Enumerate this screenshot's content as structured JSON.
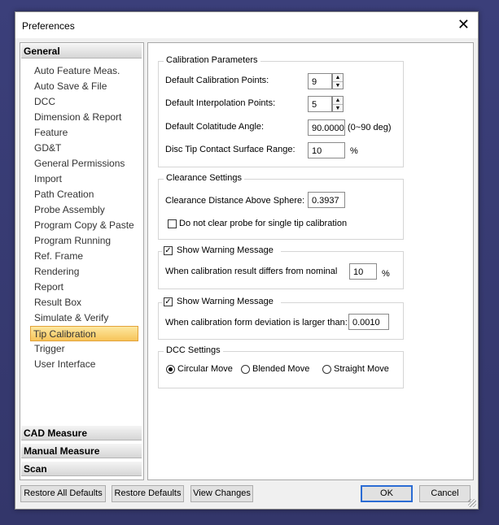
{
  "window": {
    "title": "Preferences",
    "close": "✕"
  },
  "nav": {
    "category": "General",
    "items": [
      "Auto Feature Meas.",
      "Auto Save & File",
      "DCC",
      "Dimension & Report",
      "Feature",
      "GD&T",
      "General Permissions",
      "Import",
      "Path Creation",
      "Probe Assembly",
      "Program Copy & Paste",
      "Program Running",
      "Ref. Frame",
      "Rendering",
      "Report",
      "Result Box",
      "Simulate & Verify",
      "Tip Calibration",
      "Trigger",
      "User Interface"
    ],
    "selected": "Tip Calibration",
    "bottom_categories": [
      "CAD Measure",
      "Manual Measure",
      "Scan"
    ]
  },
  "calibration": {
    "title": "Calibration Parameters",
    "points_label": "Default Calibration Points:",
    "points_value": "9",
    "interp_label": "Default Interpolation Points:",
    "interp_value": "5",
    "colat_label": "Default Colatitude Angle:",
    "colat_value": "90.0000",
    "colat_unit": "(0~90 deg)",
    "disc_label": "Disc Tip Contact Surface Range:",
    "disc_value": "10",
    "disc_unit": "%"
  },
  "clearance": {
    "title": "Clearance Settings",
    "distance_label": "Clearance Distance Above Sphere:",
    "distance_value": "0.3937",
    "noclear_label": "Do not clear probe for single tip calibration",
    "noclear_checked": false
  },
  "warn1": {
    "label": "Show Warning Message",
    "checked": true,
    "desc": "When calibration result differs from nominal",
    "value": "10",
    "unit": "%"
  },
  "warn2": {
    "label": "Show Warning Message",
    "checked": true,
    "desc": "When calibration form deviation is larger than:",
    "value": "0.0010"
  },
  "dcc": {
    "title": "DCC Settings",
    "options": [
      "Circular Move",
      "Blended Move",
      "Straight Move"
    ],
    "selected": "Circular Move"
  },
  "buttons": {
    "restore_all": "Restore All Defaults",
    "restore": "Restore Defaults",
    "view_changes": "View Changes",
    "ok": "OK",
    "cancel": "Cancel"
  }
}
